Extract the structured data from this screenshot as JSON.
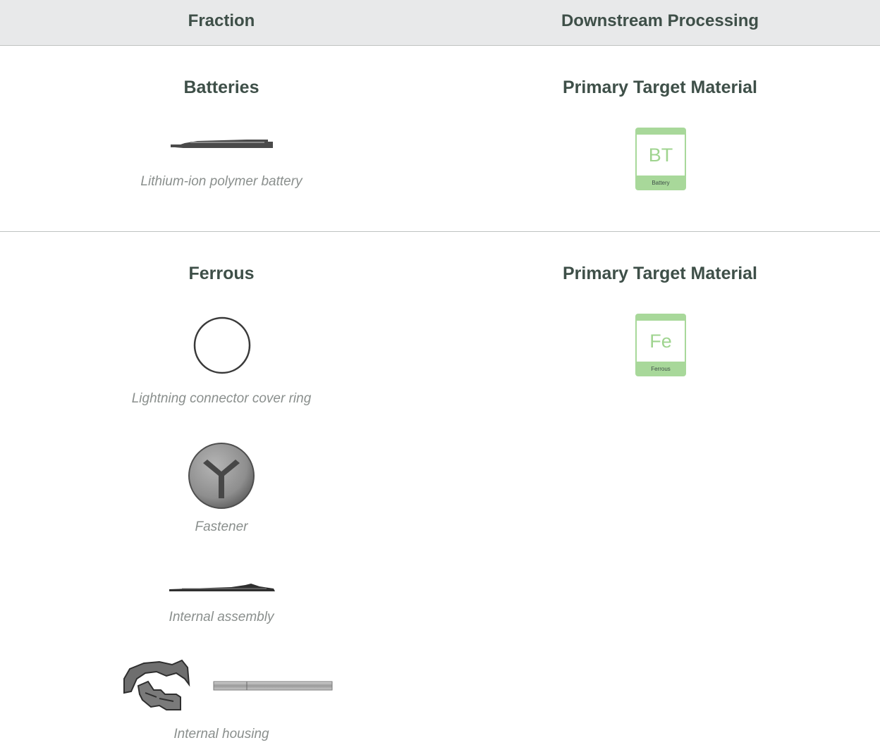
{
  "header": {
    "left_label": "Fraction",
    "right_label": "Downstream Processing"
  },
  "sections": [
    {
      "fraction_title": "Batteries",
      "processing_title": "Primary Target Material",
      "material": {
        "symbol": "BT",
        "name": "Battery"
      },
      "items": [
        {
          "caption": "Lithium-ion polymer battery",
          "icon": "battery-image"
        }
      ]
    },
    {
      "fraction_title": "Ferrous",
      "processing_title": "Primary Target Material",
      "material": {
        "symbol": "Fe",
        "name": "Ferrous"
      },
      "items": [
        {
          "caption": "Lightning connector cover ring",
          "icon": "ring-image"
        },
        {
          "caption": "Fastener",
          "icon": "screw-image"
        },
        {
          "caption": "Internal assembly",
          "icon": "assembly-image"
        },
        {
          "caption": "Internal housing",
          "icon": "housing-image"
        }
      ]
    }
  ],
  "colors": {
    "text": "#3e4f48",
    "caption": "#8a8f8d",
    "header_bg": "#e8e9ea",
    "tile_green": "#a8d89a",
    "tile_symbol": "#9fd48f"
  }
}
